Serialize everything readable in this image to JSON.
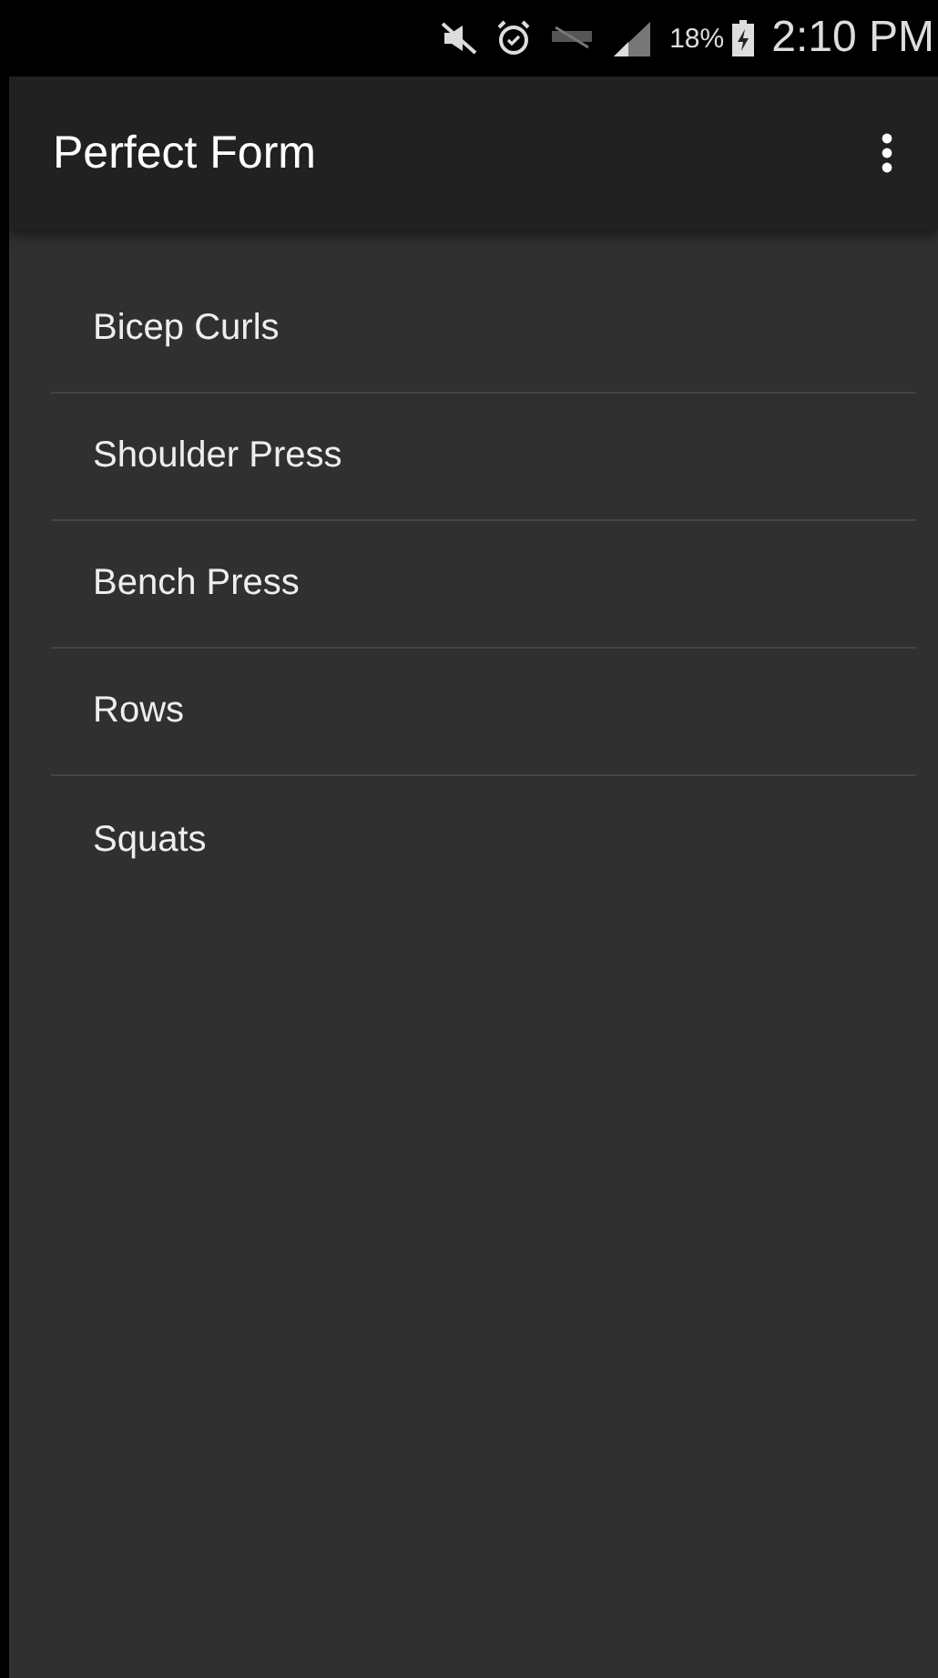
{
  "status_bar": {
    "battery": "18%",
    "time": "2:10 PM"
  },
  "app_bar": {
    "title": "Perfect Form"
  },
  "exercises": [
    {
      "label": "Bicep Curls"
    },
    {
      "label": "Shoulder Press"
    },
    {
      "label": "Bench Press"
    },
    {
      "label": "Rows"
    },
    {
      "label": "Squats"
    }
  ]
}
